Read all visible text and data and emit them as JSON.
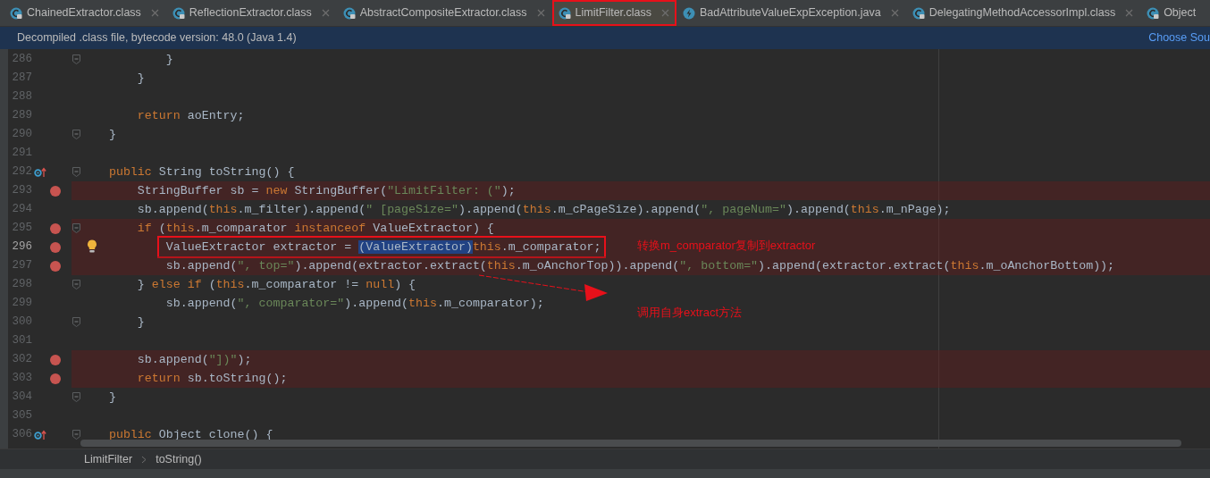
{
  "tabs": [
    {
      "label": "ChainedExtractor.class",
      "kind": "class",
      "selected": false,
      "boxed": false,
      "close": true
    },
    {
      "label": "ReflectionExtractor.class",
      "kind": "class",
      "selected": false,
      "boxed": false,
      "close": true
    },
    {
      "label": "AbstractCompositeExtractor.class",
      "kind": "class",
      "selected": false,
      "boxed": false,
      "close": true
    },
    {
      "label": "LimitFilter.class",
      "kind": "class",
      "selected": true,
      "boxed": true,
      "close": true
    },
    {
      "label": "BadAttributeValueExpException.java",
      "kind": "java",
      "selected": false,
      "boxed": false,
      "close": true
    },
    {
      "label": "DelegatingMethodAccessorImpl.class",
      "kind": "class",
      "selected": false,
      "boxed": false,
      "close": true
    },
    {
      "label": "Object",
      "kind": "class",
      "selected": false,
      "boxed": false,
      "close": false
    }
  ],
  "banner": {
    "text": "Decompiled .class file, bytecode version: 48.0 (Java 1.4)",
    "link": "Choose Sou"
  },
  "lines": [
    {
      "number": "286",
      "breakpoint": false,
      "fold": true,
      "code": [
        {
          "kind": "plain",
          "text": "            }"
        }
      ]
    },
    {
      "number": "287",
      "breakpoint": false,
      "fold": false,
      "code": [
        {
          "kind": "plain",
          "text": "        }"
        }
      ]
    },
    {
      "number": "288",
      "breakpoint": false,
      "fold": false
    },
    {
      "number": "289",
      "breakpoint": false,
      "fold": false,
      "code": [
        {
          "kind": "keyword",
          "text": "        return "
        },
        {
          "kind": "plain",
          "text": "aoEntry;"
        }
      ]
    },
    {
      "number": "290",
      "breakpoint": false,
      "fold": true,
      "code": [
        {
          "kind": "plain",
          "text": "    }"
        }
      ]
    },
    {
      "number": "291",
      "breakpoint": false,
      "fold": false
    },
    {
      "number": "292",
      "breakpoint": false,
      "fold": true,
      "gutter": {
        "kind": "override"
      },
      "code": [
        {
          "kind": "keyword",
          "text": "    public "
        },
        {
          "kind": "plain",
          "text": "String toString() {"
        }
      ]
    },
    {
      "number": "293",
      "breakpoint": true,
      "fold": false,
      "code": [
        {
          "kind": "plain",
          "text": "        StringBuffer sb = "
        },
        {
          "kind": "keyword",
          "text": "new "
        },
        {
          "kind": "plain",
          "text": "StringBuffer("
        },
        {
          "kind": "string",
          "text": "\"LimitFilter: (\""
        },
        {
          "kind": "plain",
          "text": ");"
        }
      ]
    },
    {
      "number": "294",
      "breakpoint": false,
      "fold": false,
      "code": [
        {
          "kind": "plain",
          "text": "        sb.append("
        },
        {
          "kind": "keyword",
          "text": "this"
        },
        {
          "kind": "plain",
          "text": ".m_filter).append("
        },
        {
          "kind": "string",
          "text": "\" [pageSize=\""
        },
        {
          "kind": "plain",
          "text": ").append("
        },
        {
          "kind": "keyword",
          "text": "this"
        },
        {
          "kind": "plain",
          "text": ".m_cPageSize).append("
        },
        {
          "kind": "string",
          "text": "\", pageNum=\""
        },
        {
          "kind": "plain",
          "text": ").append("
        },
        {
          "kind": "keyword",
          "text": "this"
        },
        {
          "kind": "plain",
          "text": ".m_nPage);"
        }
      ]
    },
    {
      "number": "295",
      "breakpoint": true,
      "fold": true,
      "code": [
        {
          "kind": "keyword",
          "text": "        if "
        },
        {
          "kind": "plain",
          "text": "("
        },
        {
          "kind": "keyword",
          "text": "this"
        },
        {
          "kind": "plain",
          "text": ".m_comparator "
        },
        {
          "kind": "keyword",
          "text": "instanceof "
        },
        {
          "kind": "plain",
          "text": "ValueExtractor) {"
        }
      ]
    },
    {
      "number": "296",
      "breakpoint": true,
      "fold": false,
      "current": true,
      "bulb": true,
      "boxed": true,
      "code": [
        {
          "kind": "plain",
          "text": "            ValueExtractor extractor = "
        },
        {
          "kind": "selected",
          "text": "(ValueExtractor)"
        },
        {
          "kind": "keyword",
          "text": "this"
        },
        {
          "kind": "plain",
          "text": ".m_comparator;"
        }
      ]
    },
    {
      "number": "297",
      "breakpoint": true,
      "fold": false,
      "code": [
        {
          "kind": "plain",
          "text": "            sb.append("
        },
        {
          "kind": "string",
          "text": "\", top=\""
        },
        {
          "kind": "plain",
          "text": ").append(extractor.extract("
        },
        {
          "kind": "keyword",
          "text": "this"
        },
        {
          "kind": "plain",
          "text": ".m_oAnchorTop)).append("
        },
        {
          "kind": "string",
          "text": "\", bottom=\""
        },
        {
          "kind": "plain",
          "text": ").append(extractor.extract("
        },
        {
          "kind": "keyword",
          "text": "this"
        },
        {
          "kind": "plain",
          "text": ".m_oAnchorBottom));"
        }
      ]
    },
    {
      "number": "298",
      "breakpoint": false,
      "fold": true,
      "code": [
        {
          "kind": "plain",
          "text": "        } "
        },
        {
          "kind": "keyword",
          "text": "else if "
        },
        {
          "kind": "plain",
          "text": "("
        },
        {
          "kind": "keyword",
          "text": "this"
        },
        {
          "kind": "plain",
          "text": ".m_comparator != "
        },
        {
          "kind": "keyword",
          "text": "null"
        },
        {
          "kind": "plain",
          "text": ") {"
        }
      ]
    },
    {
      "number": "299",
      "breakpoint": false,
      "fold": false,
      "code": [
        {
          "kind": "plain",
          "text": "            sb.append("
        },
        {
          "kind": "string",
          "text": "\", comparator=\""
        },
        {
          "kind": "plain",
          "text": ").append("
        },
        {
          "kind": "keyword",
          "text": "this"
        },
        {
          "kind": "plain",
          "text": ".m_comparator);"
        }
      ]
    },
    {
      "number": "300",
      "breakpoint": false,
      "fold": true,
      "code": [
        {
          "kind": "plain",
          "text": "        }"
        }
      ]
    },
    {
      "number": "301",
      "breakpoint": false,
      "fold": false
    },
    {
      "number": "302",
      "breakpoint": true,
      "fold": false,
      "code": [
        {
          "kind": "plain",
          "text": "        sb.append("
        },
        {
          "kind": "string",
          "text": "\"])\""
        },
        {
          "kind": "plain",
          "text": ");"
        }
      ]
    },
    {
      "number": "303",
      "breakpoint": true,
      "fold": false,
      "code": [
        {
          "kind": "keyword",
          "text": "        return "
        },
        {
          "kind": "plain",
          "text": "sb.toString();"
        }
      ]
    },
    {
      "number": "304",
      "breakpoint": false,
      "fold": true,
      "code": [
        {
          "kind": "plain",
          "text": "    }"
        }
      ]
    },
    {
      "number": "305",
      "breakpoint": false,
      "fold": false
    },
    {
      "number": "306",
      "breakpoint": false,
      "fold": true,
      "gutter": {
        "kind": "override"
      },
      "code": [
        {
          "kind": "keyword",
          "text": "    public "
        },
        {
          "kind": "plain",
          "text": "Object clone() {"
        }
      ]
    }
  ],
  "notes": [
    {
      "text": "转换m_comparator复制到extractor"
    },
    {
      "text": "调用自身extract方法"
    }
  ],
  "breadcrumb": [
    "LimitFilter",
    "toString()"
  ]
}
